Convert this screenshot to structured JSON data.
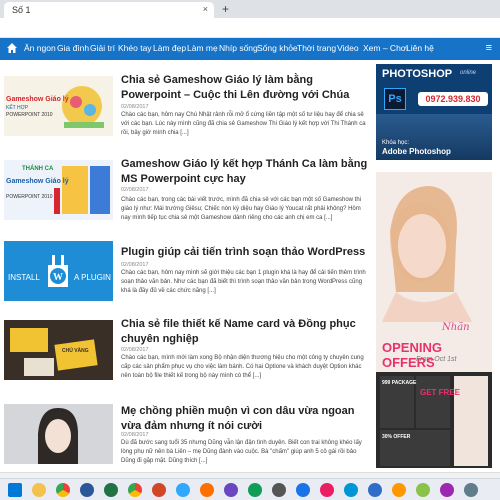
{
  "browser": {
    "tab_title": "Số 1",
    "tab_close": "×",
    "new_tab": "+"
  },
  "nav": {
    "items": [
      "Ăn ngon",
      "Gia đình",
      "Giải trí",
      "Khéo tay",
      "Làm đẹp",
      "Làm mẹ",
      "Nhíp sống",
      "Sống khỏe",
      "Thời trang",
      "Video",
      "Xem – Chơi",
      "Liên hệ"
    ],
    "menu_icon": "≡"
  },
  "articles": [
    {
      "title": "Chia sẻ Gameshow Giáo lý làm bằng Powerpoint – Cuộc thi Lên đường với Chúa",
      "date": "02/08/2017",
      "excerpt": "Chào các bạn, hôm nay Chú Nhật rảnh rỗi mở ổ cứng liền tập một số tư liệu hay để chia sẻ với các bạn. Lúc này mình cũng đã chia sẻ Gameshow Thi Giáo lý kết hợp với Thi Thánh ca rồi, bây giờ mình chia [...]",
      "thumb_text": [
        "Gameshow Giáo lý",
        "KẾT HỢP",
        "POWERPOINT 2010"
      ]
    },
    {
      "title": "Gameshow Giáo lý kết hợp Thánh Ca làm bằng MS Powerpoint cực hay",
      "date": "02/08/2017",
      "excerpt": "Chào các bạn, trong các bài viết trước, mình đã chia sẻ với các bạn một số Gameshow thi giáo lý như: Mái trường Giêsu; Chiếc nón kỳ diệu hay Giáo lý Youcat rất phải không? Hôm nay mình tiếp tục chia sẻ một Gameshow dành riêng cho các anh chị em ca [...]",
      "thumb_text": [
        "Gameshow Giáo lý",
        "THÁNH CA",
        "POWERPOINT 2010"
      ]
    },
    {
      "title": "Plugin giúp cải tiến trình soạn thảo WordPress",
      "date": "02/08/2017",
      "excerpt": "Chào các bạn, hôm nay mình sẽ giới thiệu các bạn 1 plugin khá là hay để cải tiến thêm trình soạn thảo văn bản. Như các bạn đã biết thì trình soạn thảo văn bản trong WordPress cũng khá là đầy đủ về các chức năng [...]",
      "thumb_text": [
        "INSTALL",
        "A PLUGIN"
      ]
    },
    {
      "title": "Chia sẻ file thiết kế Name card và Đồng phục chuyên nghiệp",
      "date": "02/08/2017",
      "excerpt": "Chào các bạn, mình mới làm xong Bộ nhận diện thương hiệu cho một công ty chuyên cung cấp các sản phẩm phục vụ cho việc làm bánh. Có hai Optione và khách duyệt Option khác nên toàn bộ file thiết kế trong bộ này mình có thể [...]",
      "thumb_text": [
        "CHÚ VÀNG"
      ]
    },
    {
      "title": "Mẹ chồng phiền muộn vì con dâu vừa ngoan vừa đảm nhưng ít nói cười",
      "date": "02/08/2017",
      "excerpt": "Dù đã bước sang tuổi 35 nhưng Dũng vẫn lận đận tình duyên. Biết con trai không khéo lấy lòng phụ nữ nên bà Liên – mẹ Dũng đành vào cuộc. Bà \"chấm\" giúp anh 5 cô gái rồi bảo Dũng đi gặp mặt. Dũng thích [...]",
      "thumb_text": []
    }
  ],
  "sidebar": {
    "ad1": {
      "brand": "PHOTOSHOP",
      "brand_sub": "online",
      "badge": "Ps",
      "phone": "0972.939.830",
      "line1": "Khóa học:",
      "line2": "Adobe Photoshop"
    },
    "ad2": {
      "logo": "Nhãn",
      "headline": "OPENING OFFERS",
      "date": "From Oct 1st",
      "offer1_title": "999 PACKAGE",
      "offer2_title": "GET FREE",
      "offer3_title": "30% OFFER"
    }
  },
  "colors": {
    "nav": "#1673c7",
    "accent": "#e6336b"
  }
}
